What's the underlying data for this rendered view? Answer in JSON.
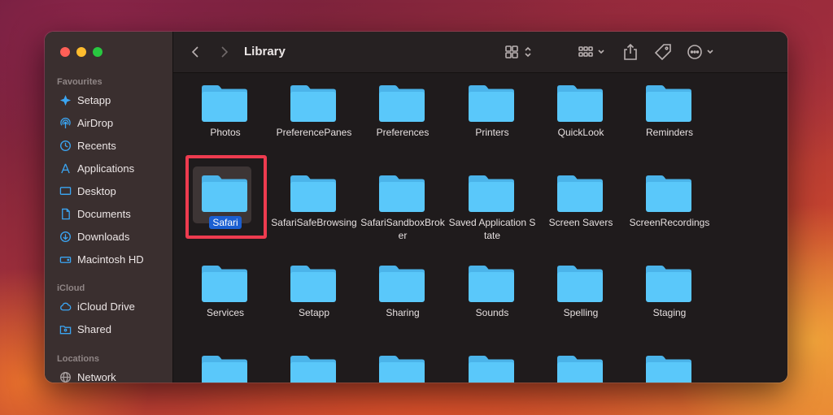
{
  "window": {
    "title": "Library"
  },
  "sidebar": {
    "sections": [
      {
        "label": "Favourites",
        "items": [
          {
            "label": "Setapp",
            "icon": "setapp-icon"
          },
          {
            "label": "AirDrop",
            "icon": "airdrop-icon"
          },
          {
            "label": "Recents",
            "icon": "clock-icon"
          },
          {
            "label": "Applications",
            "icon": "applications-icon"
          },
          {
            "label": "Desktop",
            "icon": "desktop-icon"
          },
          {
            "label": "Documents",
            "icon": "document-icon"
          },
          {
            "label": "Downloads",
            "icon": "download-icon"
          },
          {
            "label": "Macintosh HD",
            "icon": "harddrive-icon"
          }
        ]
      },
      {
        "label": "iCloud",
        "items": [
          {
            "label": "iCloud Drive",
            "icon": "cloud-icon"
          },
          {
            "label": "Shared",
            "icon": "shared-folder-icon"
          }
        ]
      },
      {
        "label": "Locations",
        "items": [
          {
            "label": "Network",
            "icon": "network-icon"
          }
        ]
      }
    ]
  },
  "toolbar": {
    "back_icon": "chevron-left-icon",
    "forward_icon": "chevron-right-icon",
    "view_icon": "grid-view-icon",
    "group_icon": "group-icon",
    "share_icon": "share-icon",
    "tag_icon": "tag-icon",
    "action_icon": "more-icon",
    "search_icon": "search-icon"
  },
  "folders": [
    {
      "name": "Photos"
    },
    {
      "name": "PreferencePanes"
    },
    {
      "name": "Preferences"
    },
    {
      "name": "Printers"
    },
    {
      "name": "QuickLook"
    },
    {
      "name": "Reminders"
    },
    {
      "name": "Safari",
      "selected": true
    },
    {
      "name": "SafariSafeBrowsing"
    },
    {
      "name": "SafariSandboxBroker"
    },
    {
      "name": "Saved Application State"
    },
    {
      "name": "Screen Savers"
    },
    {
      "name": "ScreenRecordings"
    },
    {
      "name": "Services"
    },
    {
      "name": "Setapp"
    },
    {
      "name": "Sharing"
    },
    {
      "name": "Sounds"
    },
    {
      "name": "Spelling"
    },
    {
      "name": "Staging"
    },
    {
      "name": ""
    },
    {
      "name": ""
    },
    {
      "name": ""
    },
    {
      "name": ""
    },
    {
      "name": ""
    },
    {
      "name": ""
    }
  ],
  "colors": {
    "folder": "#5ac8fa",
    "folder_tab": "#4bb4ea",
    "selection": "#1b5fd1",
    "highlight_box": "#ee3b4f"
  }
}
